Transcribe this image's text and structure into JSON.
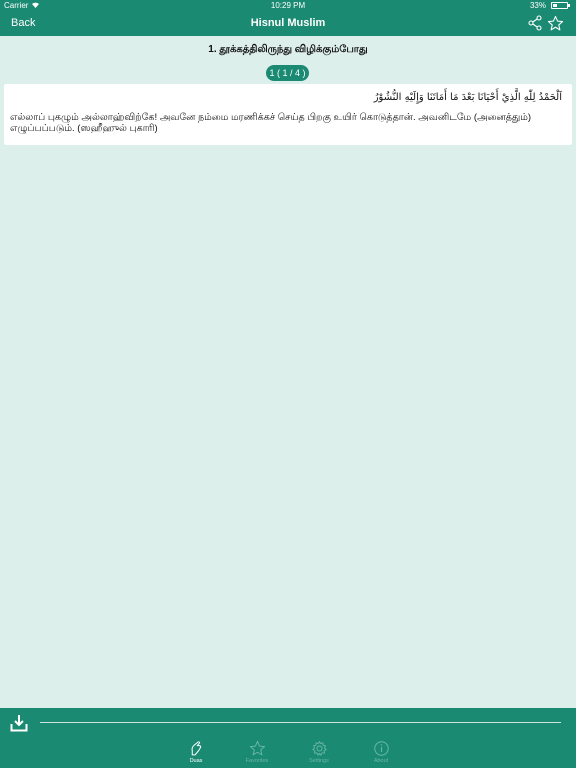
{
  "status_bar": {
    "carrier": "Carrier",
    "time": "10:29 PM",
    "battery": "33%",
    "battery_level": 0.33
  },
  "nav": {
    "back_label": "Back",
    "title": "Hisnul Muslim"
  },
  "content": {
    "heading": "1. தூக்கத்திலிருந்து விழிக்கும்போது",
    "page_indicator": "1 ( 1 / 4 )",
    "arabic": "اَلْحَمْدُ لِلّٰهِ الَّذِيْ أَحْيَانَا بَعْدَ مَا أَمَاتَنَا وَإِلَيْهِ النُّشُوْرُ",
    "translation": "எல்லாப் புகழும் அல்லாஹ்விற்கே! அவனே நம்மை மரணிக்கச் செய்த பிறகு உயிர் கொடுத்தான். அவனிடமே (அனைத்தும்) எழுப்பப்படும். (ஸஹீஹுல் புகாரி)"
  },
  "player": {
    "progress": 0
  },
  "tabs": [
    {
      "label": "Duas",
      "icon": "hands-icon",
      "active": true
    },
    {
      "label": "Favorites",
      "icon": "star-icon",
      "active": false
    },
    {
      "label": "Settings",
      "icon": "gear-icon",
      "active": false
    },
    {
      "label": "About",
      "icon": "info-icon",
      "active": false
    }
  ],
  "colors": {
    "primary": "#1b8a72",
    "background": "#dcefeb",
    "tab_inactive": "#67b7a4"
  }
}
